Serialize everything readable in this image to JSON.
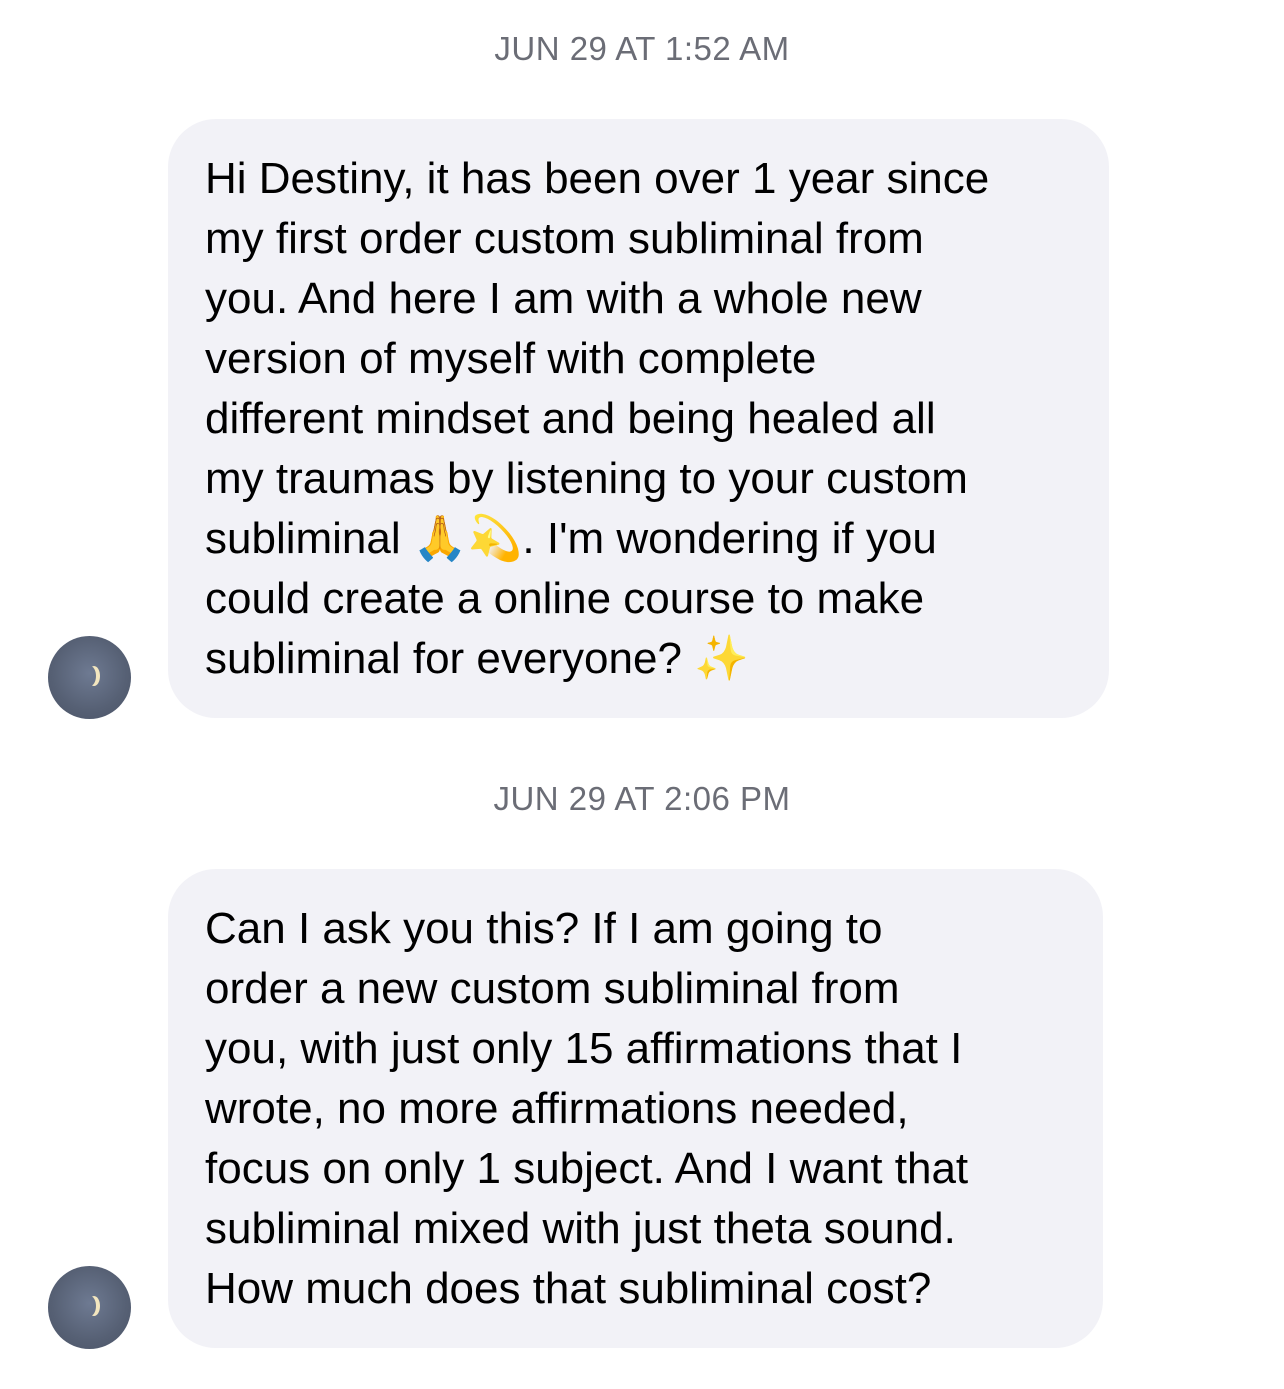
{
  "conversation": {
    "messages": [
      {
        "timestamp": "JUN 29 AT 1:52 AM",
        "lines": [
          "Hi Destiny, it has been over 1 year since",
          "my first order custom subliminal from",
          "you. And here I am with a whole new",
          "version of myself with complete",
          "different mindset and being healed all",
          "my traumas by listening to your custom",
          "subliminal 🙏💫. I'm wondering if you",
          "could create a online course to make",
          "subliminal for everyone? ✨"
        ]
      },
      {
        "timestamp": "JUN 29 AT 2:06 PM",
        "lines": [
          "Can I ask you this? If I am going to",
          "order a new custom subliminal from",
          "you, with just only 15 affirmations that I",
          "wrote, no more affirmations needed,",
          "focus on only 1 subject. And I want that",
          "subliminal mixed with just theta sound.",
          "How much does that subliminal cost?"
        ]
      }
    ],
    "avatar_icon": "moon-icon",
    "colors": {
      "bubble": "#f2f2f7",
      "timestamp": "#6b6d76",
      "text": "#000000",
      "avatar": "#566074"
    }
  }
}
